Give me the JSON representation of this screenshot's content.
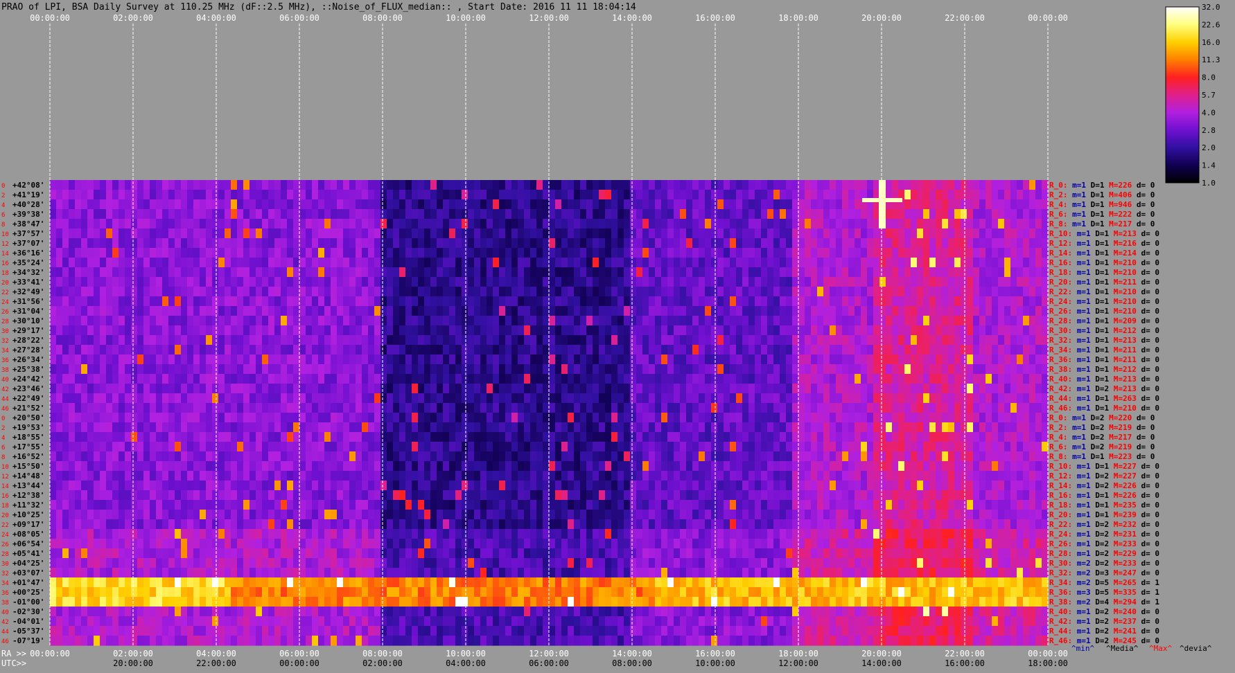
{
  "header": {
    "title": "PRAO of LPI, BSA Daily Survey at 110.25 MHz (dF::2.5 MHz), ::Noise_of_FLUX_median:: , Start Date: 2016 11 11 18:04:14"
  },
  "colors": {
    "page_background": "#999999",
    "title_text": "#000000",
    "time_label_text": "#ffffff",
    "dec_label_text": "#000000",
    "dec_index_text": "#ff0000",
    "stat_prefix_text": "#ff0000",
    "stat_min_text": "#0000aa",
    "stat_max_text": "#ff0000",
    "grid_line": "#ffffff"
  },
  "chart_data": {
    "type": "heatmap",
    "title": "PRAO of LPI, BSA Daily Survey at 110.25 MHz (dF::2.5 MHz), ::Noise_of_FLUX_median:: , Start Date: 2016 11 11 18:04:14",
    "x_axis_top_ticks": [
      "00:00:00",
      "02:00:00",
      "04:00:00",
      "06:00:00",
      "08:00:00",
      "10:00:00",
      "12:00:00",
      "14:00:00",
      "16:00:00",
      "18:00:00",
      "20:00:00",
      "22:00:00",
      "00:00:00"
    ],
    "x_axis_bottom_ra_label": "RA >>",
    "x_axis_bottom_ra_ticks": [
      "00:00:00",
      "02:00:00",
      "04:00:00",
      "06:00:00",
      "08:00:00",
      "10:00:00",
      "12:00:00",
      "14:00:00",
      "16:00:00",
      "18:00:00",
      "20:00:00",
      "22:00:00",
      "00:00:00"
    ],
    "x_axis_bottom_utc_label": "UTC>>",
    "x_axis_bottom_utc_ticks": [
      "20:00:00",
      "22:00:00",
      "00:00:00",
      "02:00:00",
      "04:00:00",
      "06:00:00",
      "08:00:00",
      "10:00:00",
      "12:00:00",
      "14:00:00",
      "16:00:00",
      "18:00:00"
    ],
    "y_row_index_labels": [
      "0",
      "2",
      "4",
      "6",
      "8",
      "10",
      "12",
      "14",
      "16",
      "18",
      "20",
      "22",
      "24",
      "26",
      "28",
      "30",
      "32",
      "34",
      "36",
      "38",
      "40",
      "42",
      "44",
      "46",
      "0",
      "2",
      "4",
      "6",
      "8",
      "10",
      "12",
      "14",
      "16",
      "18",
      "20",
      "22",
      "24",
      "26",
      "28",
      "30",
      "32",
      "34",
      "36",
      "38",
      "40",
      "42",
      "44",
      "46"
    ],
    "y_declination_labels": [
      "+42°08'",
      "+41°19'",
      "+40°28'",
      "+39°38'",
      "+38°47'",
      "+37°57'",
      "+37°07'",
      "+36°16'",
      "+35°24'",
      "+34°32'",
      "+33°41'",
      "+32°49'",
      "+31°56'",
      "+31°04'",
      "+30°10'",
      "+29°17'",
      "+28°22'",
      "+27°28'",
      "+26°34'",
      "+25°38'",
      "+24°42'",
      "+23°46'",
      "+22°49'",
      "+21°52'",
      "+20°50'",
      "+19°53'",
      "+18°55'",
      "+17°55'",
      "+16°52'",
      "+15°50'",
      "+14°48'",
      "+13°44'",
      "+12°38'",
      "+11°32'",
      "+10°25'",
      "+09°17'",
      "+08°05'",
      "+06°54'",
      "+05°41'",
      "+04°25'",
      "+03°07'",
      "+01°47'",
      "+00°25'",
      "-01°00'",
      "-02°30'",
      "-04°01'",
      "-05°37'",
      "-07°19'"
    ],
    "color_scale": {
      "ticks": [
        "32.0",
        "22.6",
        "16.0",
        "11.3",
        "8.0",
        "5.7",
        "4.0",
        "2.8",
        "2.0",
        "1.4",
        "1.0"
      ],
      "gradient": [
        "#ffffff",
        "#ffff80",
        "#ffd000",
        "#ff8000",
        "#ff2020",
        "#e0208a",
        "#b020e0",
        "#7010d0",
        "#3010a0",
        "#100050",
        "#000000"
      ]
    },
    "row_stats": [
      {
        "r": "R_0:",
        "m": "m=1",
        "d1": "D=1",
        "M": "M=226",
        "d": "d= 0"
      },
      {
        "r": "R_2:",
        "m": "m=1",
        "d1": "D=1",
        "M": "M=406",
        "d": "d= 0"
      },
      {
        "r": "R_4:",
        "m": "m=1",
        "d1": "D=1",
        "M": "M=946",
        "d": "d= 0"
      },
      {
        "r": "R_6:",
        "m": "m=1",
        "d1": "D=1",
        "M": "M=222",
        "d": "d= 0"
      },
      {
        "r": "R_8:",
        "m": "m=1",
        "d1": "D=1",
        "M": "M=217",
        "d": "d= 0"
      },
      {
        "r": "R_10:",
        "m": "m=1",
        "d1": "D=1",
        "M": "M=213",
        "d": "d= 0"
      },
      {
        "r": "R_12:",
        "m": "m=1",
        "d1": "D=1",
        "M": "M=216",
        "d": "d= 0"
      },
      {
        "r": "R_14:",
        "m": "m=1",
        "d1": "D=1",
        "M": "M=214",
        "d": "d= 0"
      },
      {
        "r": "R_16:",
        "m": "m=1",
        "d1": "D=1",
        "M": "M=210",
        "d": "d= 0"
      },
      {
        "r": "R_18:",
        "m": "m=1",
        "d1": "D=1",
        "M": "M=210",
        "d": "d= 0"
      },
      {
        "r": "R_20:",
        "m": "m=1",
        "d1": "D=1",
        "M": "M=211",
        "d": "d= 0"
      },
      {
        "r": "R_22:",
        "m": "m=1",
        "d1": "D=1",
        "M": "M=210",
        "d": "d= 0"
      },
      {
        "r": "R_24:",
        "m": "m=1",
        "d1": "D=1",
        "M": "M=210",
        "d": "d= 0"
      },
      {
        "r": "R_26:",
        "m": "m=1",
        "d1": "D=1",
        "M": "M=210",
        "d": "d= 0"
      },
      {
        "r": "R_28:",
        "m": "m=1",
        "d1": "D=1",
        "M": "M=209",
        "d": "d= 0"
      },
      {
        "r": "R_30:",
        "m": "m=1",
        "d1": "D=1",
        "M": "M=212",
        "d": "d= 0"
      },
      {
        "r": "R_32:",
        "m": "m=1",
        "d1": "D=1",
        "M": "M=213",
        "d": "d= 0"
      },
      {
        "r": "R_34:",
        "m": "m=1",
        "d1": "D=1",
        "M": "M=211",
        "d": "d= 0"
      },
      {
        "r": "R_36:",
        "m": "m=1",
        "d1": "D=1",
        "M": "M=211",
        "d": "d= 0"
      },
      {
        "r": "R_38:",
        "m": "m=1",
        "d1": "D=1",
        "M": "M=212",
        "d": "d= 0"
      },
      {
        "r": "R_40:",
        "m": "m=1",
        "d1": "D=1",
        "M": "M=213",
        "d": "d= 0"
      },
      {
        "r": "R_42:",
        "m": "m=1",
        "d1": "D=2",
        "M": "M=213",
        "d": "d= 0"
      },
      {
        "r": "R_44:",
        "m": "m=1",
        "d1": "D=1",
        "M": "M=263",
        "d": "d= 0"
      },
      {
        "r": "R_46:",
        "m": "m=1",
        "d1": "D=1",
        "M": "M=210",
        "d": "d= 0"
      },
      {
        "r": "R_0:",
        "m": "m=1",
        "d1": "D=2",
        "M": "M=220",
        "d": "d= 0"
      },
      {
        "r": "R_2:",
        "m": "m=1",
        "d1": "D=2",
        "M": "M=219",
        "d": "d= 0"
      },
      {
        "r": "R_4:",
        "m": "m=1",
        "d1": "D=2",
        "M": "M=217",
        "d": "d= 0"
      },
      {
        "r": "R_6:",
        "m": "m=1",
        "d1": "D=2",
        "M": "M=219",
        "d": "d= 0"
      },
      {
        "r": "R_8:",
        "m": "m=1",
        "d1": "D=1",
        "M": "M=223",
        "d": "d= 0"
      },
      {
        "r": "R_10:",
        "m": "m=1",
        "d1": "D=1",
        "M": "M=227",
        "d": "d= 0"
      },
      {
        "r": "R_12:",
        "m": "m=1",
        "d1": "D=2",
        "M": "M=227",
        "d": "d= 0"
      },
      {
        "r": "R_14:",
        "m": "m=1",
        "d1": "D=2",
        "M": "M=226",
        "d": "d= 0"
      },
      {
        "r": "R_16:",
        "m": "m=1",
        "d1": "D=1",
        "M": "M=226",
        "d": "d= 0"
      },
      {
        "r": "R_18:",
        "m": "m=1",
        "d1": "D=1",
        "M": "M=235",
        "d": "d= 0"
      },
      {
        "r": "R_20:",
        "m": "m=1",
        "d1": "D=1",
        "M": "M=239",
        "d": "d= 0"
      },
      {
        "r": "R_22:",
        "m": "m=1",
        "d1": "D=2",
        "M": "M=232",
        "d": "d= 0"
      },
      {
        "r": "R_24:",
        "m": "m=1",
        "d1": "D=2",
        "M": "M=231",
        "d": "d= 0"
      },
      {
        "r": "R_26:",
        "m": "m=1",
        "d1": "D=2",
        "M": "M=233",
        "d": "d= 0"
      },
      {
        "r": "R_28:",
        "m": "m=1",
        "d1": "D=2",
        "M": "M=229",
        "d": "d= 0"
      },
      {
        "r": "R_30:",
        "m": "m=2",
        "d1": "D=2",
        "M": "M=233",
        "d": "d= 0"
      },
      {
        "r": "R_32:",
        "m": "m=2",
        "d1": "D=3",
        "M": "M=247",
        "d": "d= 0"
      },
      {
        "r": "R_34:",
        "m": "m=2",
        "d1": "D=5",
        "M": "M=265",
        "d": "d= 1"
      },
      {
        "r": "R_36:",
        "m": "m=3",
        "d1": "D=5",
        "M": "M=335",
        "d": "d= 1"
      },
      {
        "r": "R_38:",
        "m": "m=2",
        "d1": "D=4",
        "M": "M=294",
        "d": "d= 1"
      },
      {
        "r": "R_40:",
        "m": "m=1",
        "d1": "D=2",
        "M": "M=240",
        "d": "d= 0"
      },
      {
        "r": "R_42:",
        "m": "m=1",
        "d1": "D=2",
        "M": "M=237",
        "d": "d= 0"
      },
      {
        "r": "R_44:",
        "m": "m=1",
        "d1": "D=2",
        "M": "M=241",
        "d": "d= 0"
      },
      {
        "r": "R_46:",
        "m": "m=1",
        "d1": "D=2",
        "M": "M=245",
        "d": "d= 0"
      }
    ],
    "stats_footer": {
      "min": "^min^",
      "median": "^Media^",
      "max": "^Max^",
      "devia": "^devia^"
    }
  }
}
